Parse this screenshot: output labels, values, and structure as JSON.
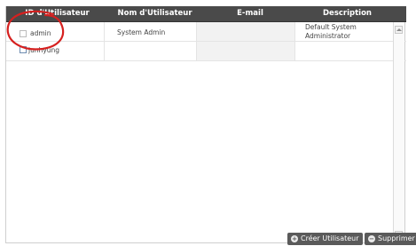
{
  "table": {
    "columns": [
      "ID d'Utilisateur",
      "Nom d'Utilisateur",
      "E-mail",
      "Description"
    ],
    "rows": [
      {
        "id": "admin",
        "name": "System Admin",
        "email": "",
        "description_line1": "Default System",
        "description_line2": "Administrator"
      },
      {
        "id": "junhyung",
        "name": "",
        "email": "",
        "description_line1": "",
        "description_line2": ""
      }
    ]
  },
  "annotation": {
    "color": "#d6201f"
  },
  "actions": {
    "create_label": "Créer Utilisateur",
    "delete_label": "Supprimer"
  }
}
